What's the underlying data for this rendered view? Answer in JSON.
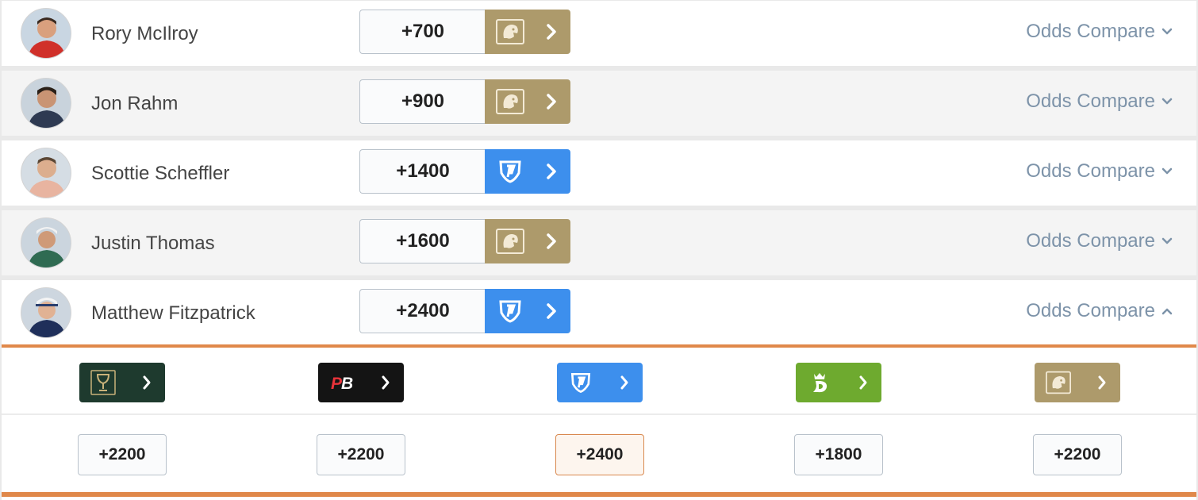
{
  "players": [
    {
      "name": "Rory McIlroy",
      "odds": "+700",
      "book": "mgm-lion-icon",
      "book_color": "#ad9a6b",
      "compare_label": "Odds Compare",
      "expanded": false
    },
    {
      "name": "Jon Rahm",
      "odds": "+900",
      "book": "mgm-lion-icon",
      "book_color": "#ad9a6b",
      "compare_label": "Odds Compare",
      "expanded": false
    },
    {
      "name": "Scottie Scheffler",
      "odds": "+1400",
      "book": "fanduel-shield-icon",
      "book_color": "#3d8fed",
      "compare_label": "Odds Compare",
      "expanded": false
    },
    {
      "name": "Justin Thomas",
      "odds": "+1600",
      "book": "mgm-lion-icon",
      "book_color": "#ad9a6b",
      "compare_label": "Odds Compare",
      "expanded": false
    },
    {
      "name": "Matthew Fitzpatrick",
      "odds": "+2400",
      "book": "fanduel-shield-icon",
      "book_color": "#3d8fed",
      "compare_label": "Odds Compare",
      "expanded": true
    }
  ],
  "compare_panel": {
    "books": [
      {
        "icon": "caesars-goblet-icon",
        "color": "#1e3a2e",
        "odds": "+2200",
        "best": false
      },
      {
        "icon": "pointsbet-pb-icon",
        "color": "#141414",
        "odds": "+2200",
        "best": false
      },
      {
        "icon": "fanduel-shield-icon",
        "color": "#3d8fed",
        "odds": "+2400",
        "best": true
      },
      {
        "icon": "draftkings-crown-icon",
        "color": "#6eaa2f",
        "odds": "+1800",
        "best": false
      },
      {
        "icon": "mgm-lion-icon",
        "color": "#ad9a6b",
        "odds": "+2200",
        "best": false
      }
    ]
  },
  "colors": {
    "accent_orange": "#e0884a",
    "link_blue_grey": "#7d93a9"
  }
}
